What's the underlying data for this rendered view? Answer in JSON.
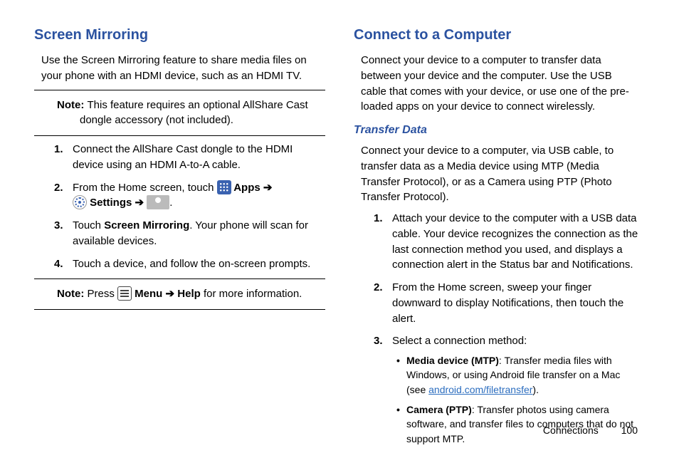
{
  "left": {
    "heading": "Screen Mirroring",
    "intro": "Use the Screen Mirroring feature to share media files on your phone with an HDMI device, such as an HDMI TV.",
    "note1_label": "Note: ",
    "note1_text": "This feature requires an optional AllShare Cast dongle accessory (not included).",
    "step1": "Connect the AllShare Cast dongle to the HDMI device using an HDMI A-to-A cable.",
    "step2_a": "From the Home screen, touch ",
    "step2_apps": " Apps ",
    "step2_arrow1": "➔",
    "step2_settings": " Settings ",
    "step2_arrow2": "➔ ",
    "step2_end": ".",
    "step3_a": "Touch ",
    "step3_bold": "Screen Mirroring",
    "step3_b": ". Your phone will scan for available devices.",
    "step4": "Touch a device, and follow the on-screen prompts.",
    "note2_label": "Note: ",
    "note2_a": "Press ",
    "note2_menu": " Menu ",
    "note2_arrow": "➔ ",
    "note2_help": "Help",
    "note2_b": " for more information."
  },
  "right": {
    "heading": "Connect to a Computer",
    "intro": "Connect your device to a computer to transfer data between your device and the computer. Use the USB cable that comes with your device, or use one of the pre-loaded apps on your device to connect wirelessly.",
    "sub": "Transfer Data",
    "sub_intro": "Connect your device to a computer, via USB cable, to transfer data as a Media device using MTP (Media Transfer Protocol), or as a Camera using PTP (Photo Transfer Protocol).",
    "step1": "Attach your device to the computer with a USB data cable. Your device recognizes the connection as the last connection method you used, and displays a connection alert in the Status bar and Notifications.",
    "step2": "From the Home screen, sweep your finger downward to display Notifications, then touch the alert.",
    "step3": "Select a connection method:",
    "bullet1_label": "Media device (MTP)",
    "bullet1_text": ": Transfer media files with Windows, or using Android file transfer on a Mac (see ",
    "bullet1_link": "android.com/filetransfer",
    "bullet1_end": ").",
    "bullet2_label": "Camera (PTP)",
    "bullet2_text": ": Transfer photos using camera software, and transfer files to computers that do not support MTP."
  },
  "footer": {
    "section": "Connections",
    "page": "100"
  }
}
